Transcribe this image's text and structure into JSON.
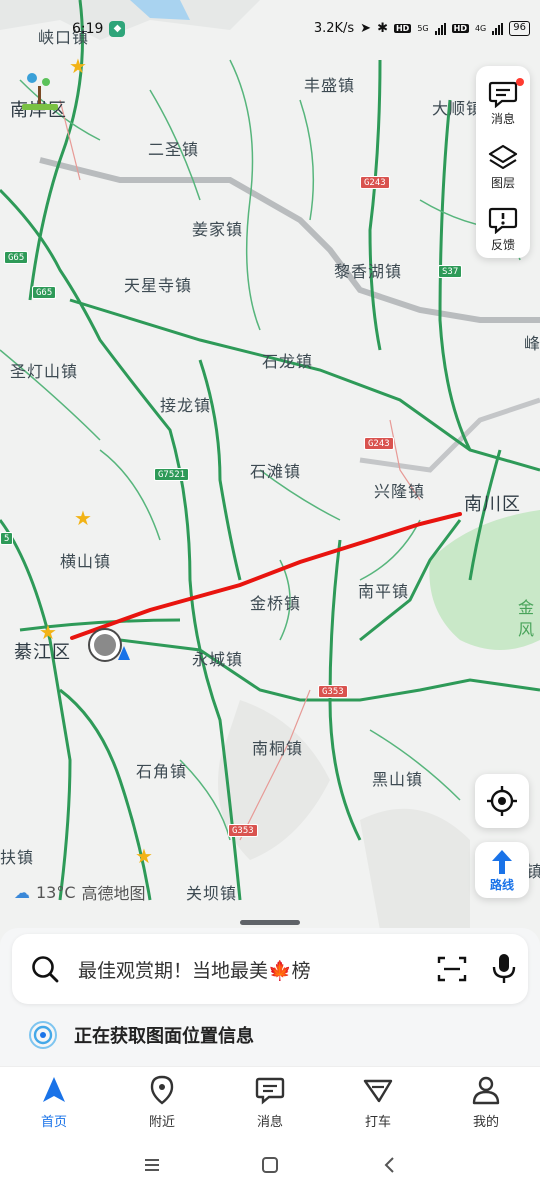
{
  "status_bar": {
    "time": "6:19",
    "network_speed": "3.2K/s",
    "net_5g": "5G",
    "net_4g": "4G",
    "hd": "HD",
    "battery": "96"
  },
  "map": {
    "places": [
      {
        "id": "xiakou",
        "name": "峡口镇"
      },
      {
        "id": "nanan",
        "name": "南岸区"
      },
      {
        "id": "fengsheng",
        "name": "丰盛镇"
      },
      {
        "id": "dashun",
        "name": "大顺镇"
      },
      {
        "id": "ersheng",
        "name": "二圣镇"
      },
      {
        "id": "jiangjia",
        "name": "姜家镇"
      },
      {
        "id": "tianxingsi",
        "name": "天星寺镇"
      },
      {
        "id": "lixianghu",
        "name": "黎香湖镇"
      },
      {
        "id": "feng",
        "name": "峰"
      },
      {
        "id": "shengdengshan",
        "name": "圣灯山镇"
      },
      {
        "id": "shilong",
        "name": "石龙镇"
      },
      {
        "id": "jielong",
        "name": "接龙镇"
      },
      {
        "id": "shitan",
        "name": "石滩镇"
      },
      {
        "id": "xinglong",
        "name": "兴隆镇"
      },
      {
        "id": "nanchuan",
        "name": "南川区"
      },
      {
        "id": "hengshan",
        "name": "横山镇"
      },
      {
        "id": "nanping",
        "name": "南平镇"
      },
      {
        "id": "jinqiao",
        "name": "金桥镇"
      },
      {
        "id": "qijiang",
        "name": "綦江区"
      },
      {
        "id": "yongcheng",
        "name": "永城镇"
      },
      {
        "id": "nantong",
        "name": "南桐镇"
      },
      {
        "id": "heishan",
        "name": "黑山镇"
      },
      {
        "id": "shijiao",
        "name": "石角镇"
      },
      {
        "id": "guanba",
        "name": "关坝镇"
      },
      {
        "id": "fu",
        "name": "扶镇"
      },
      {
        "id": "jinfo",
        "name": "金"
      },
      {
        "id": "jinfo2",
        "name": "风"
      },
      {
        "id": "zhen_edge",
        "name": "镇"
      }
    ],
    "road_shields": [
      {
        "id": "g243a",
        "label": "G243",
        "kind": "national"
      },
      {
        "id": "g65a",
        "label": "G65",
        "kind": "expressway"
      },
      {
        "id": "g65b",
        "label": "G65",
        "kind": "expressway"
      },
      {
        "id": "s37",
        "label": "S37",
        "kind": "expressway"
      },
      {
        "id": "g243b",
        "label": "G243",
        "kind": "national"
      },
      {
        "id": "g7521",
        "label": "G7521",
        "kind": "expressway"
      },
      {
        "id": "g353a",
        "label": "G353",
        "kind": "national"
      },
      {
        "id": "g353b",
        "label": "G353",
        "kind": "national"
      },
      {
        "id": "s5",
        "label": "5",
        "kind": "expressway"
      }
    ],
    "route_color": "#e8140f",
    "expressway_color": "#2e9a58",
    "national_color": "#d9534f",
    "weather": {
      "temperature": "13°C",
      "brand": "高德地图"
    }
  },
  "tool_panel": {
    "messages": "消息",
    "layers": "图层",
    "feedback": "反馈"
  },
  "route_button": "路线",
  "search": {
    "placeholder": "最佳观赏期！当地最美🍁榜"
  },
  "location_status": "正在获取图面位置信息",
  "tabs": [
    {
      "id": "home",
      "label": "首页",
      "active": true
    },
    {
      "id": "nearby",
      "label": "附近",
      "active": false
    },
    {
      "id": "messages",
      "label": "消息",
      "active": false
    },
    {
      "id": "taxi",
      "label": "打车",
      "active": false
    },
    {
      "id": "mine",
      "label": "我的",
      "active": false
    }
  ]
}
